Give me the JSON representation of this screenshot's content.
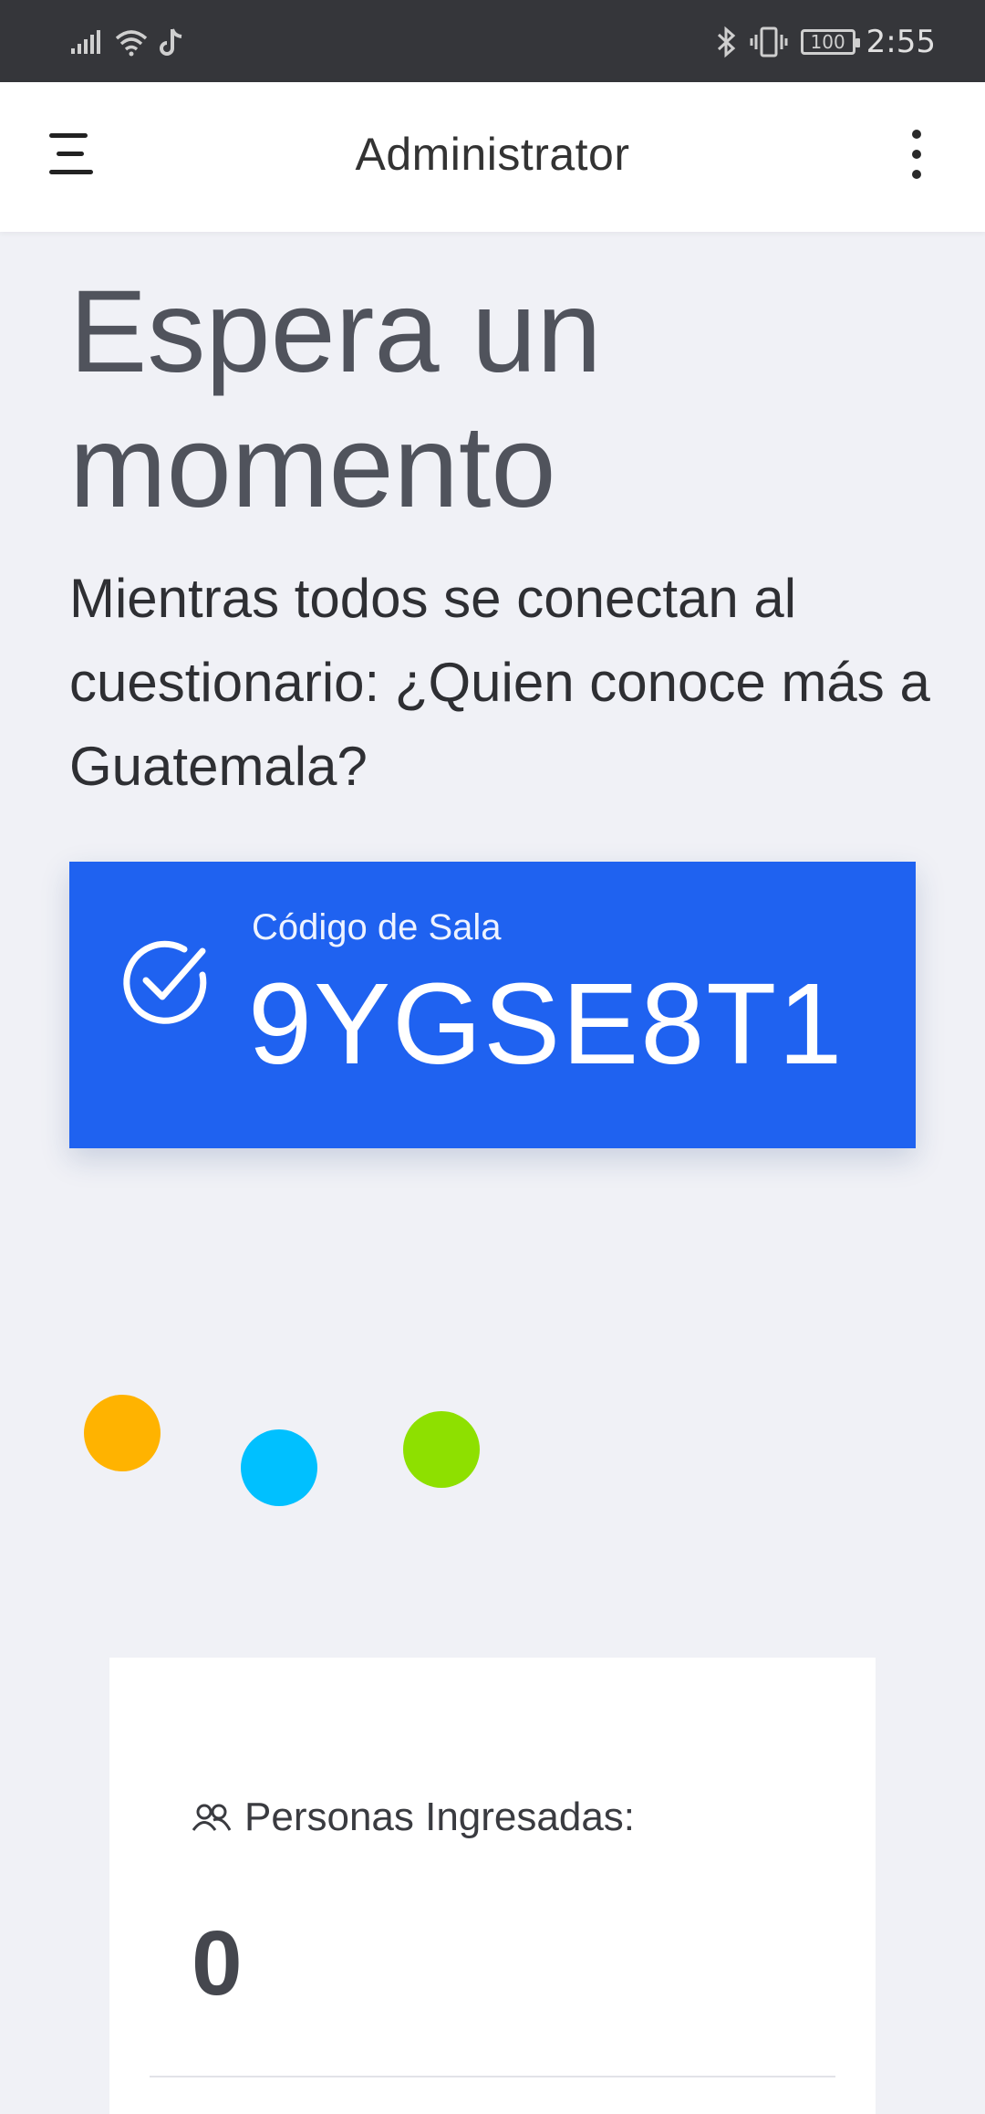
{
  "status_bar": {
    "time": "2:55",
    "battery": "100",
    "icons": [
      "signal-icon",
      "wifi-icon",
      "tiktok-icon",
      "bluetooth-icon",
      "vibrate-icon",
      "battery-icon"
    ]
  },
  "app_bar": {
    "title": "Administrator",
    "icons": [
      "menu-icon",
      "more-vert-icon"
    ]
  },
  "main": {
    "headline": "Espera un momento",
    "subtitle": "Mientras todos se conectan al cuestionario: ¿Quien conoce más a Guatemala?",
    "room": {
      "label": "Código de Sala",
      "code": "9YGSE8T1",
      "icon": "check-circle-icon"
    },
    "loader_colors": [
      "#ffb300",
      "#00c0ff",
      "#8ee000"
    ],
    "participants": {
      "label": "Personas Ingresadas:",
      "count": "0",
      "icon": "people-icon"
    }
  },
  "colors": {
    "accent": "#1f62f0",
    "background": "#f0f1f6",
    "status_bar": "#35363a"
  }
}
